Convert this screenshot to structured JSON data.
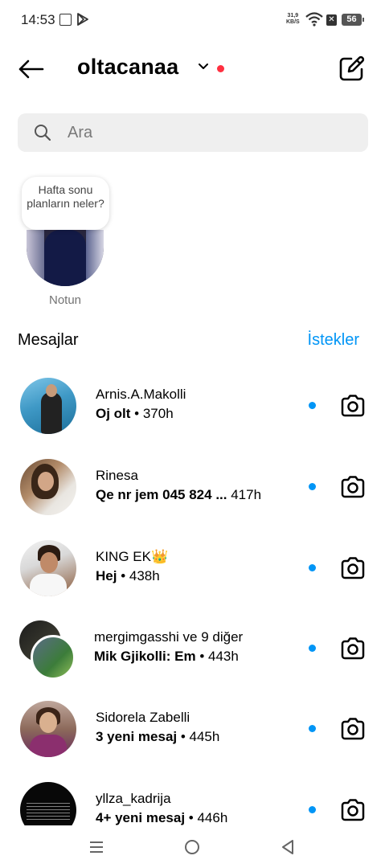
{
  "status_bar": {
    "time": "14:53",
    "net_speed_value": "31,9",
    "net_speed_unit": "KB/S",
    "sim_badge": "✕",
    "battery": "56"
  },
  "header": {
    "account_name": "oltacanaa",
    "icons": {
      "back": "arrow-left-icon",
      "compose": "edit-icon",
      "chevron": "chevron-down-icon"
    },
    "accent_color": "#ff3040"
  },
  "search": {
    "placeholder": "Ara"
  },
  "note": {
    "text": "Hafta sonu planların neler?",
    "label": "Notun"
  },
  "messages": {
    "title": "Mesajlar",
    "requests_label": "İstekler",
    "link_color": "#0095f6"
  },
  "threads": [
    {
      "name": "Arnis.A.Makolli",
      "preview": "Oj olt",
      "time": " • 370h",
      "unread": true
    },
    {
      "name": "Rinesa",
      "preview": "Qe nr jem 045 824 ...",
      "time": "  417h",
      "unread": true
    },
    {
      "name": "KING EK👑",
      "preview": "Hej",
      "time": " • 438h",
      "unread": true
    },
    {
      "name": "mergimgasshi ve 9 diğer",
      "preview": "Mik Gjikolli: Em",
      "time": " • 443h",
      "unread": true
    },
    {
      "name": "Sidorela Zabelli",
      "preview": "3 yeni mesaj",
      "time": " • 445h",
      "unread": true
    },
    {
      "name": "yllza_kadrija",
      "preview": "4+ yeni mesaj",
      "time": " • 446h",
      "unread": true
    }
  ]
}
